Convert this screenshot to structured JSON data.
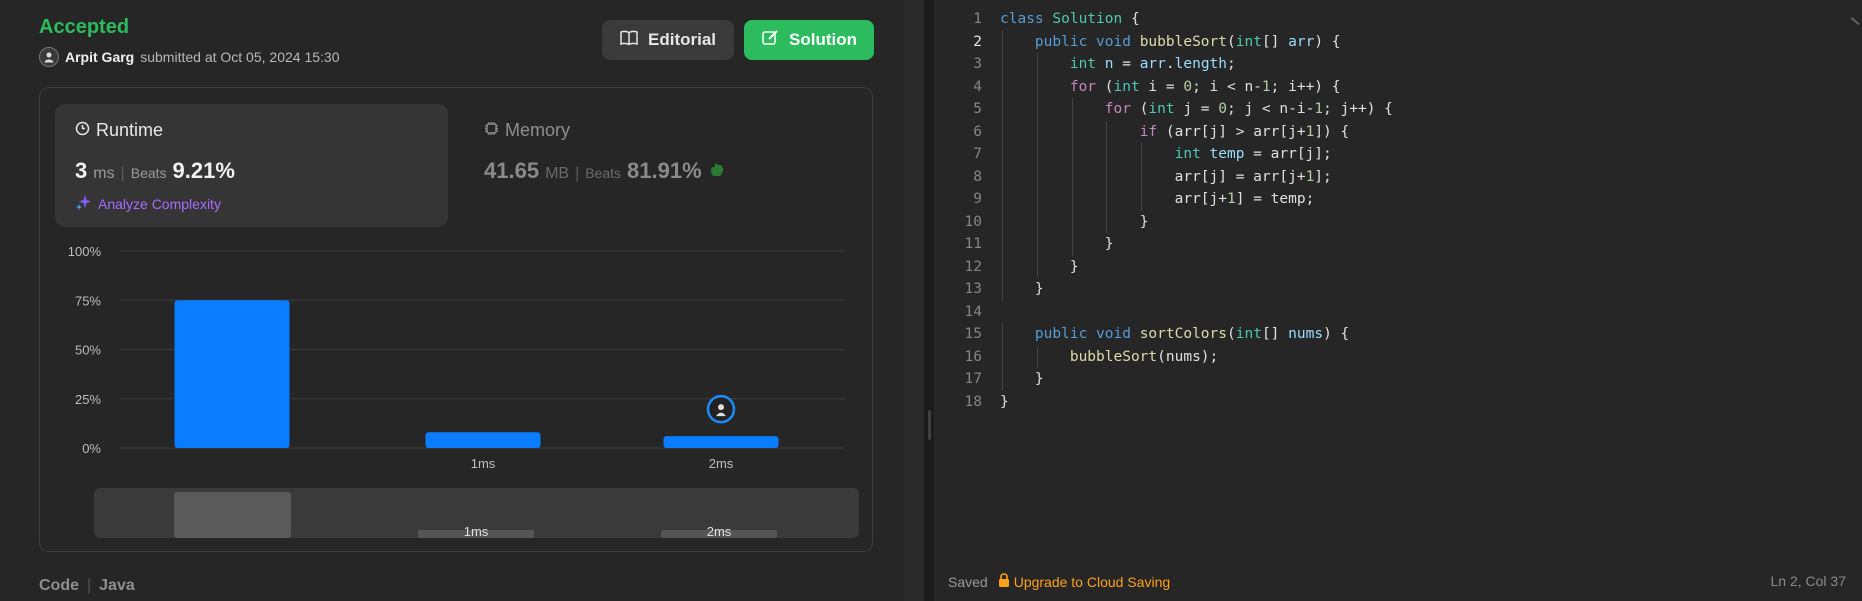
{
  "result": {
    "status": "Accepted",
    "user": "Arpit Garg",
    "submitted_text": "submitted at Oct 05, 2024 15:30"
  },
  "buttons": {
    "editorial": "Editorial",
    "solution": "Solution"
  },
  "runtime": {
    "title": "Runtime",
    "value": "3",
    "unit": "ms",
    "beats_label": "Beats",
    "beats_pct": "9.21%",
    "analyze": "Analyze Complexity"
  },
  "memory": {
    "title": "Memory",
    "value": "41.65",
    "unit": "MB",
    "beats_label": "Beats",
    "beats_pct": "81.91%"
  },
  "chart_data": {
    "type": "bar",
    "categories": [
      "",
      "1ms",
      "2ms"
    ],
    "values": [
      75,
      8,
      6
    ],
    "yticks": [
      "100%",
      "75%",
      "50%",
      "25%",
      "0%"
    ],
    "ylim": [
      0,
      100
    ],
    "bar_color": "#0a7cff",
    "highlight_category": "2ms",
    "overview_labels": [
      "1ms",
      "2ms"
    ]
  },
  "code_label": {
    "code": "Code",
    "lang": "Java"
  },
  "editor": {
    "active_line": 2,
    "lines": [
      [
        [
          "class ",
          "cl"
        ],
        [
          "Solution",
          "ty"
        ],
        [
          " {",
          ""
        ]
      ],
      [
        [
          "    ",
          ""
        ],
        [
          "public ",
          "cl"
        ],
        [
          "void ",
          "cl"
        ],
        [
          "bubbleSort",
          "fn"
        ],
        [
          "(",
          ""
        ],
        [
          "int",
          "ty"
        ],
        [
          "[] ",
          ""
        ],
        [
          "arr",
          "var"
        ],
        [
          ") {",
          ""
        ]
      ],
      [
        [
          "        ",
          ""
        ],
        [
          "int ",
          "ty"
        ],
        [
          "n",
          "var"
        ],
        [
          " = ",
          ""
        ],
        [
          "arr",
          "var"
        ],
        [
          ".",
          ""
        ],
        [
          "length",
          "var"
        ],
        [
          ";",
          ""
        ]
      ],
      [
        [
          "        ",
          ""
        ],
        [
          "for ",
          "kw"
        ],
        [
          "(",
          ""
        ],
        [
          "int ",
          "ty"
        ],
        [
          "i = ",
          ""
        ],
        [
          "0",
          "num"
        ],
        [
          "; i < n-",
          ""
        ],
        [
          "1",
          "num"
        ],
        [
          "; i++) {",
          ""
        ]
      ],
      [
        [
          "            ",
          ""
        ],
        [
          "for ",
          "kw"
        ],
        [
          "(",
          ""
        ],
        [
          "int ",
          "ty"
        ],
        [
          "j = ",
          ""
        ],
        [
          "0",
          "num"
        ],
        [
          "; j < n-i-",
          ""
        ],
        [
          "1",
          "num"
        ],
        [
          "; j++) {",
          ""
        ]
      ],
      [
        [
          "                ",
          ""
        ],
        [
          "if ",
          "kw"
        ],
        [
          "(arr[j] > arr[j+",
          ""
        ],
        [
          "1",
          "num"
        ],
        [
          "]) {",
          ""
        ]
      ],
      [
        [
          "                    ",
          ""
        ],
        [
          "int ",
          "ty"
        ],
        [
          "temp",
          "var"
        ],
        [
          " = arr[j];",
          ""
        ]
      ],
      [
        [
          "                    ",
          ""
        ],
        [
          "arr[j] = arr[j+",
          ""
        ],
        [
          "1",
          "num"
        ],
        [
          "];",
          ""
        ]
      ],
      [
        [
          "                    ",
          ""
        ],
        [
          "arr[j+",
          ""
        ],
        [
          "1",
          "num"
        ],
        [
          "] = temp;",
          ""
        ]
      ],
      [
        [
          "                ",
          ""
        ],
        [
          "}",
          ""
        ]
      ],
      [
        [
          "            ",
          ""
        ],
        [
          "}",
          ""
        ]
      ],
      [
        [
          "        ",
          ""
        ],
        [
          "}",
          ""
        ]
      ],
      [
        [
          "    ",
          ""
        ],
        [
          "}",
          ""
        ]
      ],
      [
        [
          "",
          ""
        ]
      ],
      [
        [
          "    ",
          ""
        ],
        [
          "public ",
          "cl"
        ],
        [
          "void ",
          "cl"
        ],
        [
          "sortColors",
          "fn"
        ],
        [
          "(",
          ""
        ],
        [
          "int",
          "ty"
        ],
        [
          "[] ",
          ""
        ],
        [
          "nums",
          "var"
        ],
        [
          ") {",
          ""
        ]
      ],
      [
        [
          "        ",
          ""
        ],
        [
          "bubbleSort",
          "fn"
        ],
        [
          "(nums);",
          ""
        ]
      ],
      [
        [
          "    ",
          ""
        ],
        [
          "}",
          ""
        ]
      ],
      [
        [
          "}",
          ""
        ]
      ]
    ]
  },
  "footer": {
    "saved": "Saved",
    "upgrade": "Upgrade to Cloud Saving",
    "position": "Ln 2, Col 37"
  }
}
